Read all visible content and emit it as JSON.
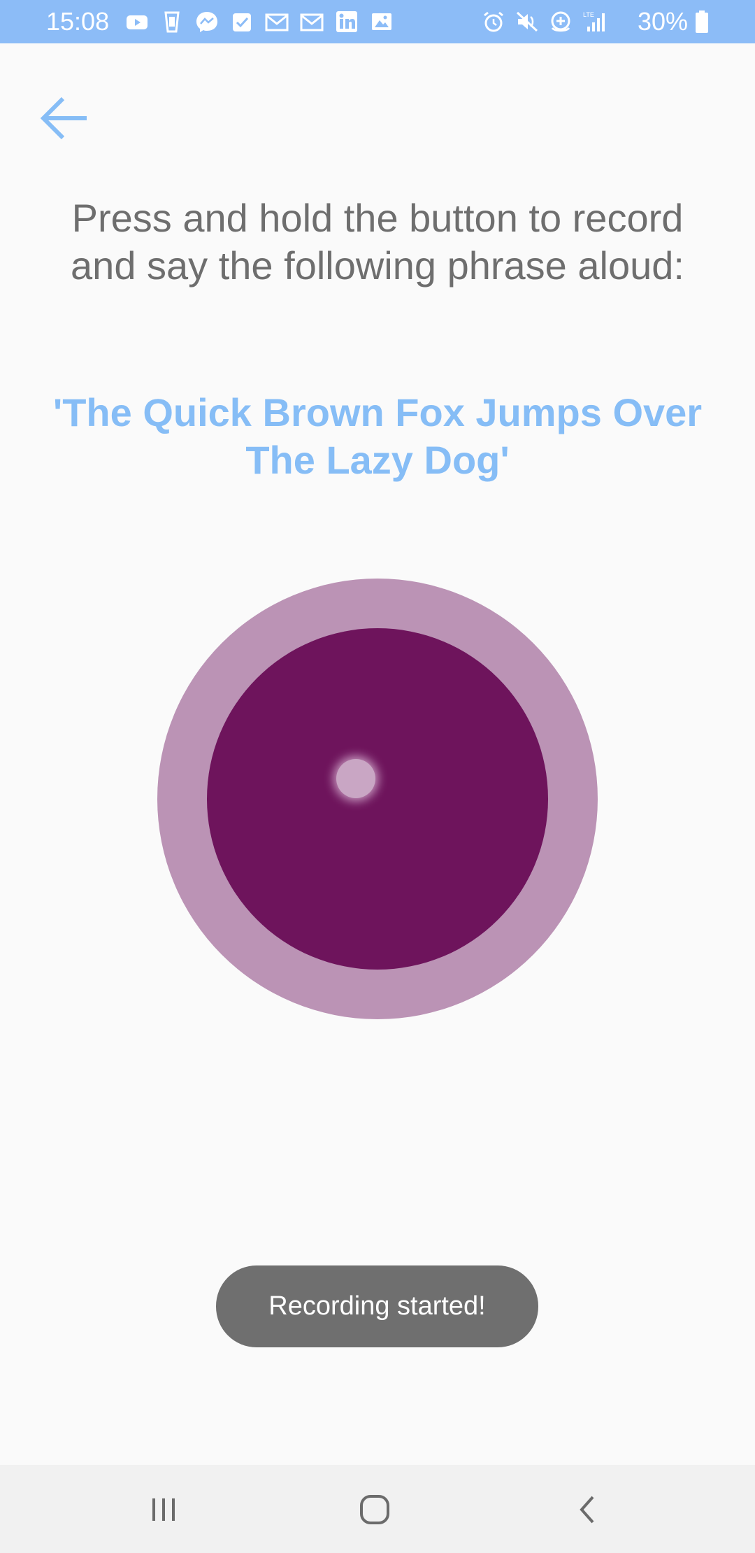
{
  "status_bar": {
    "time": "15:08",
    "battery": "30%",
    "left_icons": [
      "youtube-icon",
      "cup-icon",
      "messenger-icon",
      "checkbox-icon",
      "gmail-icon",
      "gmail-icon-2",
      "linkedin-icon",
      "gallery-icon"
    ],
    "right_icons": [
      "alarm-icon",
      "mute-icon",
      "data-saver-icon",
      "lte-signal-icon"
    ],
    "background_color": "#8cbcf7"
  },
  "header": {
    "back_icon": "arrow-left-icon"
  },
  "instruction": {
    "line1": "Press and hold the button to record",
    "line2": "and say the following phrase aloud:"
  },
  "phrase": {
    "line1": "'The Quick Brown Fox Jumps Over",
    "line2": "The Lazy Dog'",
    "color": "#86bdf6"
  },
  "record_button": {
    "outer_color": "#bb93b5",
    "inner_color": "#6e145c",
    "state": "recording"
  },
  "toast": {
    "message": "Recording started!"
  },
  "nav_bar": {
    "recent_icon": "recent-apps-icon",
    "home_icon": "home-icon",
    "back_icon": "back-icon"
  }
}
